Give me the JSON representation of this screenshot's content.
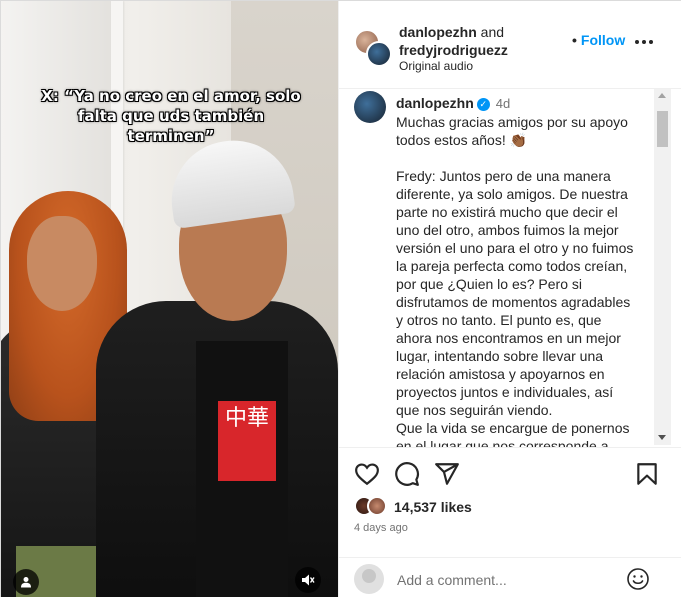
{
  "media": {
    "overlay_caption": "X: “Ya no creo en el amor, solo falta que uds también terminen”",
    "shirt_print": "中華"
  },
  "header": {
    "user1": "danlopezhn",
    "and_text": "and",
    "user2": "fredyjrodriguezz",
    "audio": "Original audio",
    "follow_label": "Follow"
  },
  "caption": {
    "username": "danlopezhn",
    "time": "4d",
    "text": "Muchas gracias amigos por su apoyo todos estos años! 👏🏾\n\nFredy: Juntos pero de una manera diferente, ya solo amigos. De nuestra parte no existirá mucho que decir el uno del otro, ambos fuimos la mejor versión el uno para el otro y no fuimos la pareja perfecta como todos creían, por que ¿Quien lo es? Pero si disfrutamos de momentos agradables y otros no tanto. El punto es, que ahora nos encontramos en un mejor lugar, intentando sobre llevar una relación amistosa y apoyarnos en proyectos juntos e individuales, así que nos seguirán viendo.\nQue la vida se encargue de ponernos en el lugar que nos corresponde a"
  },
  "engagement": {
    "likes": "14,537 likes",
    "time_ago": "4 days ago"
  },
  "comment_box": {
    "placeholder": "Add a comment..."
  },
  "colors": {
    "link_blue": "#0095f6",
    "text": "#262626",
    "muted": "#737373"
  }
}
